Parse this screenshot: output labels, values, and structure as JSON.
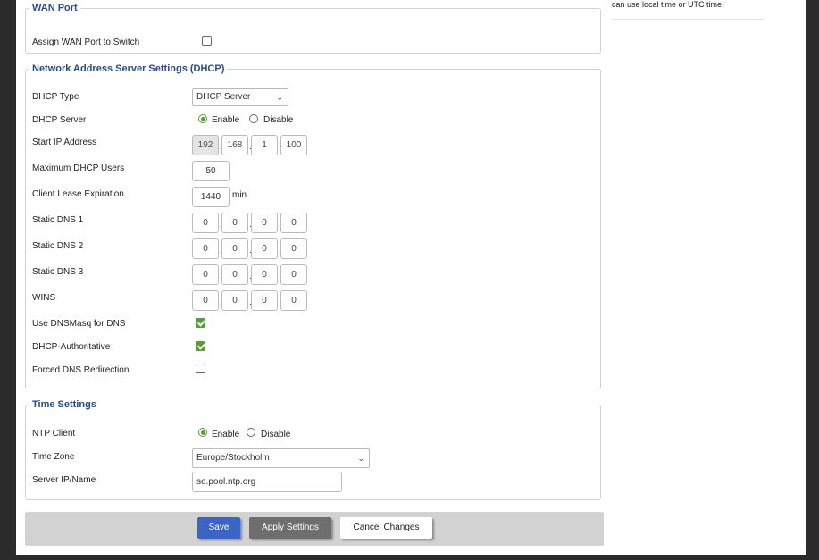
{
  "help": {
    "text": "can use local time or UTC time."
  },
  "wan_port": {
    "legend": "WAN Port",
    "assign_label": "Assign WAN Port to Switch",
    "assign_checked": false
  },
  "dhcp": {
    "legend": "Network Address Server Settings (DHCP)",
    "type_label": "DHCP Type",
    "type_value": "DHCP Server",
    "server_label": "DHCP Server",
    "enable_label": "Enable",
    "disable_label": "Disable",
    "server_selected": "Enable",
    "start_ip_label": "Start IP Address",
    "start_ip": [
      "192",
      "168",
      "1",
      "100"
    ],
    "max_users_label": "Maximum DHCP Users",
    "max_users": "50",
    "lease_label": "Client Lease Expiration",
    "lease_value": "1440",
    "lease_unit": "min",
    "dns1_label": "Static DNS 1",
    "dns1": [
      "0",
      "0",
      "0",
      "0"
    ],
    "dns2_label": "Static DNS 2",
    "dns2": [
      "0",
      "0",
      "0",
      "0"
    ],
    "dns3_label": "Static DNS 3",
    "dns3": [
      "0",
      "0",
      "0",
      "0"
    ],
    "wins_label": "WINS",
    "wins": [
      "0",
      "0",
      "0",
      "0"
    ],
    "dnsmasq_label": "Use DNSMasq for DNS",
    "dnsmasq_checked": true,
    "authoritative_label": "DHCP-Authoritative",
    "authoritative_checked": true,
    "forced_dns_label": "Forced DNS Redirection",
    "forced_dns_checked": false
  },
  "time": {
    "legend": "Time Settings",
    "ntp_label": "NTP Client",
    "enable_label": "Enable",
    "disable_label": "Disable",
    "ntp_selected": "Enable",
    "tz_label": "Time Zone",
    "tz_value": "Europe/Stockholm",
    "server_label": "Server IP/Name",
    "server_value": "se.pool.ntp.org"
  },
  "buttons": {
    "save": "Save",
    "apply": "Apply Settings",
    "cancel": "Cancel Changes"
  },
  "colors": {
    "legend": "#2a4a8a",
    "save_bg": "#3a65c4",
    "apply_bg": "#6e6e6e",
    "check_green": "#5a9b3c"
  }
}
